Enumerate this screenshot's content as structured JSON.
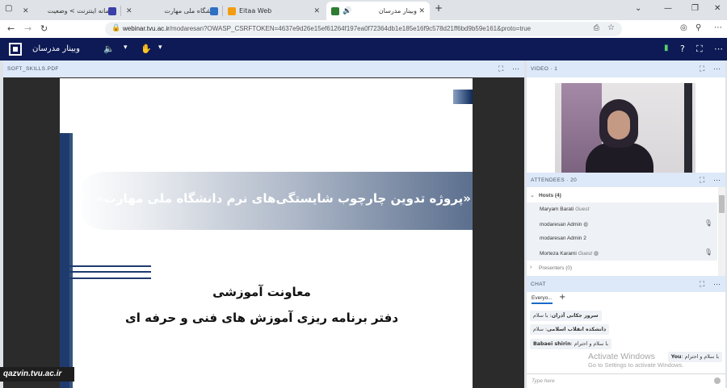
{
  "browser": {
    "tabs": [
      {
        "label": "سامانه اینترنت > وضعیت",
        "favicon_color": "#3b3fa8"
      },
      {
        "label": "دانشگاه ملی مهارت",
        "favicon_color": "#2e70c4"
      },
      {
        "label": "Eitaa Web",
        "favicon_color": "#f39c12"
      },
      {
        "label": "وبینار مدرسان",
        "favicon_color": "#2e7d32"
      }
    ],
    "url_host": "webinar.tvu.ac.ir",
    "url_path": "/modaresan?OWASP_CSRFTOKEN=4637e9d26e15ef61264f197ea0f72364db1e185e16f9c578d21ff6bd9b59e161&proto=true"
  },
  "app": {
    "title": "وبینار مدرسان"
  },
  "panels": {
    "presentation_title": "SOFT_SKILLS.PDF",
    "video_title": "VIDEO · 1",
    "attendees_title": "ATTENDEES · 20",
    "chat_title": "CHAT"
  },
  "slide": {
    "banner": "«پروژه تدوین چارچوب شایستگی‌های نرم دانشگاه ملی مهارت»",
    "subtitle1": "معاونت آموزشی",
    "subtitle2": "دفتر برنامه ریزی آموزش های فنی و حرفه ای"
  },
  "watermark": "qazvin.tvu.ac.ir",
  "attendees": {
    "hosts_label": "Hosts (4)",
    "presenters_label": "Presenters (0)",
    "members": [
      {
        "name": "Maryam Barati",
        "role": "Guest"
      },
      {
        "name": "modaresan Admin",
        "role": ""
      },
      {
        "name": "modaresan Admin 2",
        "role": ""
      },
      {
        "name": "Morteza Karami",
        "role": "Guest"
      }
    ]
  },
  "chat": {
    "tab_label": "Everyo...",
    "messages": [
      {
        "sender": "سرور جکانی آذران",
        "text": "با سلام"
      },
      {
        "sender": "دانشکده انقلاب اسلامی",
        "text": "سلام"
      },
      {
        "sender": "Babaei shirin",
        "text": "با سلام و احترام"
      },
      {
        "sender": "You",
        "text": "با سلام و احترام"
      }
    ],
    "input_placeholder": "Type here",
    "activate_line1": "Activate Windows",
    "activate_line2": "Go to Settings to activate Windows."
  }
}
